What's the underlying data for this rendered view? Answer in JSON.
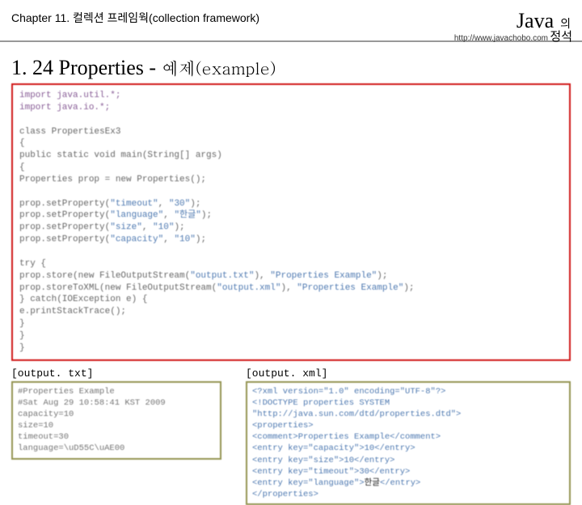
{
  "header": {
    "chapter": "Chapter 11. 컬렉션 프레임웍(collection framework)",
    "brand_main": "Java",
    "brand_sub1": "의",
    "brand_sub2": "정석",
    "url": "http://www.javachobo.com"
  },
  "title": {
    "num": "1. 24 Properties",
    "dash": " - ",
    "kor": "예제(example)"
  },
  "code": {
    "l1": "import java.util.*;",
    "l2": "import java.io.*;",
    "l3": "class PropertiesEx3",
    "l4": "{",
    "l5a": "    public static void main(String[] args)",
    "l6": "    {",
    "l7": "        Properties prop = new Properties();",
    "l8a": "        prop.setProperty(",
    "s8a": "\"timeout\"",
    "s8b": "\"30\"",
    "l8e": ");",
    "l9a": "        prop.setProperty(",
    "s9a": "\"language\"",
    "s9b": "\"한글\"",
    "l9e": ");",
    "l10a": "        prop.setProperty(",
    "s10a": "\"size\"",
    "s10b": "\"10\"",
    "l10e": ");",
    "l11a": "        prop.setProperty(",
    "s11a": "\"capacity\"",
    "s11b": "\"10\"",
    "l11e": ");",
    "l12": "        try {",
    "l13a": "            prop.store(new FileOutputStream(",
    "s13a": "\"output.txt\"",
    "s13b": "\"Properties Example\"",
    "l13e": ");",
    "l14a": "            prop.storeToXML(new FileOutputStream(",
    "s14a": "\"output.xml\"",
    "s14b": "\"Properties Example\"",
    "l14e": ");",
    "l15": "        } catch(IOException e) {",
    "l16": "            e.printStackTrace();",
    "l17": "        }",
    "l18": "    }",
    "l19": "}"
  },
  "out": {
    "txt_label": "[output. txt]",
    "xml_label": "[output. xml]",
    "txt": {
      "l1": "#Properties Example",
      "l2": "#Sat Aug 29 10:58:41 KST 2009",
      "l3": "capacity=10",
      "l4": "size=10",
      "l5": "timeout=30",
      "l6": "language=\\uD55C\\uAE00"
    },
    "xml": {
      "l1": "<?xml version=\"1.0\" encoding=\"UTF-8\"?>",
      "l2": "<!DOCTYPE properties SYSTEM \"http://java.sun.com/dtd/properties.dtd\">",
      "l3": "<properties>",
      "l4": "<comment>Properties Example</comment>",
      "l5": "<entry key=\"capacity\">10</entry>",
      "l6": "<entry key=\"size\">10</entry>",
      "l7": "<entry key=\"timeout\">30</entry>",
      "l8a": "<entry key=\"language\">",
      "l8k": "한글",
      "l8b": "</entry>",
      "l9": "</properties>"
    }
  }
}
